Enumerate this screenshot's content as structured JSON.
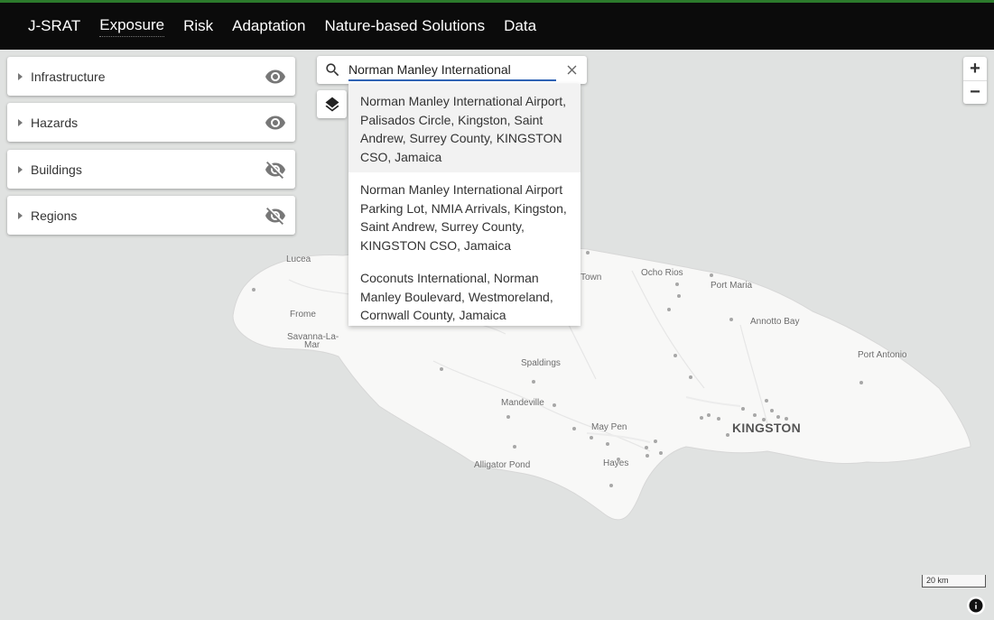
{
  "nav": {
    "brand": "J-SRAT",
    "items": [
      "Exposure",
      "Risk",
      "Adaptation",
      "Nature-based Solutions",
      "Data"
    ],
    "active": "Exposure"
  },
  "layer_panels": [
    {
      "label": "Infrastructure",
      "visible": true
    },
    {
      "label": "Hazards",
      "visible": true
    },
    {
      "label": "Buildings",
      "visible": false
    },
    {
      "label": "Regions",
      "visible": false
    }
  ],
  "search": {
    "value": "Norman Manley International",
    "suggestions": [
      "Norman Manley International Airport, Palisados Circle, Kingston, Saint Andrew, Surrey County, KINGSTON CSO, Jamaica",
      "Norman Manley International Airport Parking Lot, NMIA Arrivals, Kingston, Saint Andrew, Surrey County, KINGSTON CSO, Jamaica",
      "Coconuts International, Norman Manley Boulevard, Westmoreland, Cornwall County, Jamaica"
    ]
  },
  "map": {
    "places": {
      "lucea": "Lucea",
      "frome": "Frome",
      "savanna": "Savanna-La-",
      "savanna2": "Mar",
      "town": "Town",
      "ocho_rios": "Ocho Rios",
      "port_maria": "Port Maria",
      "annotto_bay": "Annotto Bay",
      "port_antonio": "Port Antonio",
      "spaldings": "Spaldings",
      "mandeville": "Mandeville",
      "may_pen": "May Pen",
      "kingston": "KINGSTON",
      "alligator_pond": "Alligator Pond",
      "hayes": "Hayes"
    },
    "zoom_in": "+",
    "zoom_out": "−",
    "scale": "20 km"
  },
  "colors": {
    "topbar": "#0b0b0b",
    "accent": "#2c7a2c",
    "input_underline": "#2f63b5"
  }
}
